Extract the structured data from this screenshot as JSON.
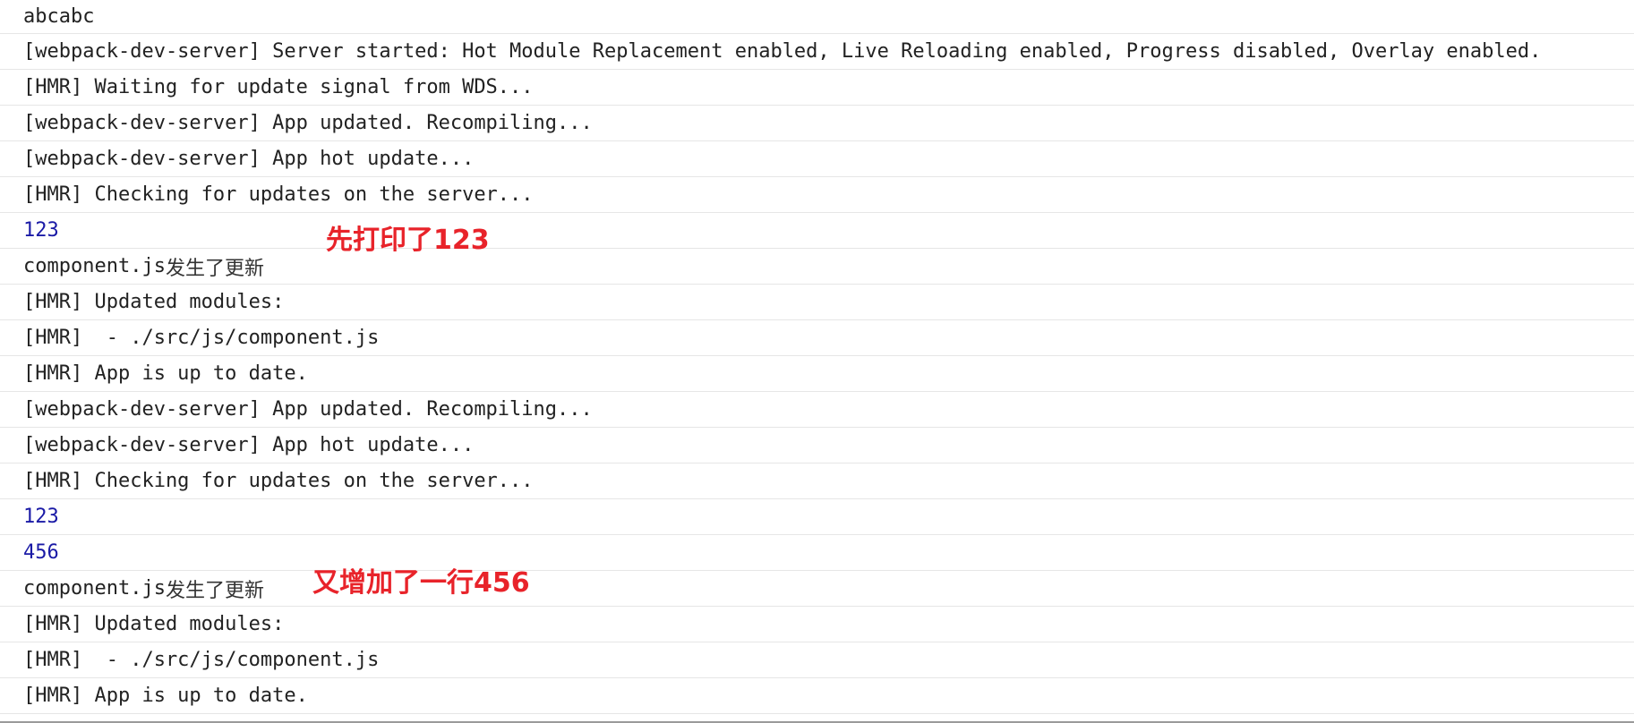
{
  "console": {
    "rows": [
      {
        "text": "abcabc",
        "kind": "log"
      },
      {
        "text": "[webpack-dev-server] Server started: Hot Module Replacement enabled, Live Reloading enabled, Progress disabled, Overlay enabled.",
        "kind": "log"
      },
      {
        "text": "[HMR] Waiting for update signal from WDS...",
        "kind": "log"
      },
      {
        "text": "[webpack-dev-server] App updated. Recompiling...",
        "kind": "log"
      },
      {
        "text": "[webpack-dev-server] App hot update...",
        "kind": "log"
      },
      {
        "text": "[HMR] Checking for updates on the server...",
        "kind": "log"
      },
      {
        "text": "123",
        "kind": "number"
      },
      {
        "text": "component.js",
        "cjk": "发生了更新",
        "kind": "log"
      },
      {
        "text": "[HMR] Updated modules:",
        "kind": "log"
      },
      {
        "text": "[HMR]  - ./src/js/component.js",
        "kind": "log"
      },
      {
        "text": "[HMR] App is up to date.",
        "kind": "log"
      },
      {
        "text": "[webpack-dev-server] App updated. Recompiling...",
        "kind": "log"
      },
      {
        "text": "[webpack-dev-server] App hot update...",
        "kind": "log"
      },
      {
        "text": "[HMR] Checking for updates on the server...",
        "kind": "log"
      },
      {
        "text": "123",
        "kind": "number"
      },
      {
        "text": "456",
        "kind": "number"
      },
      {
        "text": "component.js",
        "cjk": "发生了更新",
        "kind": "log"
      },
      {
        "text": "[HMR] Updated modules:",
        "kind": "log"
      },
      {
        "text": "[HMR]  - ./src/js/component.js",
        "kind": "log"
      },
      {
        "text": "[HMR] App is up to date.",
        "kind": "log"
      }
    ]
  },
  "annotations": {
    "first": "先打印了123",
    "second": "又增加了一行456"
  },
  "colors": {
    "log_text": "#222222",
    "number_text": "#1a1aa6",
    "annotation": "#e8232a",
    "row_divider": "#e6e6e6"
  }
}
